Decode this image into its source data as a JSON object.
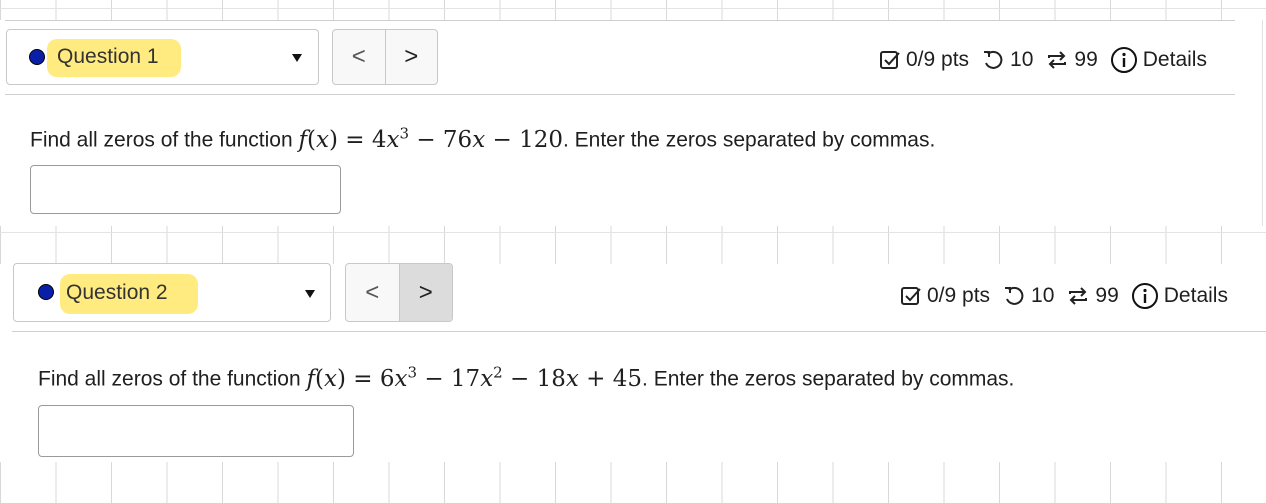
{
  "questions": [
    {
      "label": "Question 1",
      "points": "0/9 pts",
      "retries": "10",
      "submissions": "99",
      "details": "Details",
      "prompt_before": "Find all zeros of the function",
      "prompt_after": ". Enter the zeros separated by commas.",
      "formula": "f(x) = 4x^3 − 76x − 120",
      "answer_value": ""
    },
    {
      "label": "Question 2",
      "points": "0/9 pts",
      "retries": "10",
      "submissions": "99",
      "details": "Details",
      "prompt_before": "Find all zeros of the function",
      "prompt_after": ". Enter the zeros separated by commas.",
      "formula": "f(x) = 6x^3 − 17x^2 − 18x + 45",
      "answer_value": ""
    }
  ],
  "nav": {
    "prev": "<",
    "next": ">"
  },
  "colors": {
    "status_dot": "#0a1fa8",
    "highlight": "#ffe868"
  }
}
